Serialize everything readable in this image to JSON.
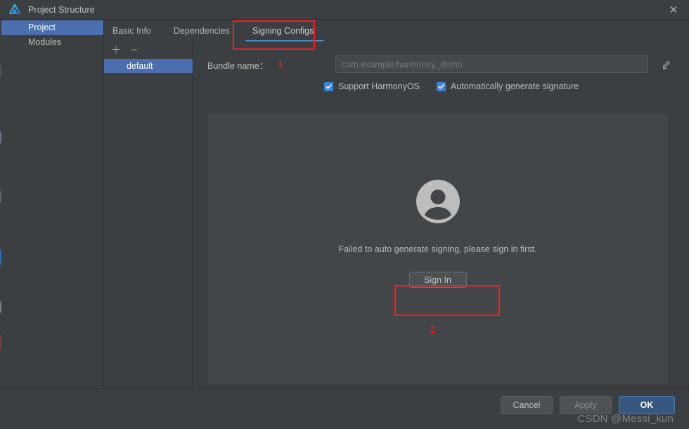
{
  "window": {
    "title": "Project Structure",
    "logo_icon": "deveco-studio-logo-icon",
    "close_icon": "close-icon",
    "close_glyph": "✕"
  },
  "categories": {
    "items": [
      {
        "label": "Project",
        "selected": true
      },
      {
        "label": "Modules",
        "selected": false
      }
    ]
  },
  "tabs": [
    {
      "label": "Basic Info",
      "active": false
    },
    {
      "label": "Dependencies",
      "active": false
    },
    {
      "label": "Signing Configs",
      "active": true
    }
  ],
  "configs_pane": {
    "add_icon": "plus-icon",
    "add_glyph": "＋",
    "remove_icon": "minus-icon",
    "remove_glyph": "−",
    "items": [
      {
        "label": "default",
        "selected": true
      }
    ]
  },
  "form": {
    "bundle_label": "Bundle name：",
    "bundle_value": "",
    "bundle_placeholder": "com.example.harmoney_demo",
    "edit_icon": "pencil-edit-icon",
    "checkboxes": [
      {
        "label": "Support HarmonyOS",
        "checked": true
      },
      {
        "label": "Automatically generate signature",
        "checked": true
      }
    ]
  },
  "signing_panel": {
    "avatar_icon": "user-avatar-icon",
    "message": "Failed to auto generate signing, please sign in first.",
    "sign_in_label": "Sign In"
  },
  "footer": {
    "cancel_label": "Cancel",
    "apply_label": "Apply",
    "ok_label": "OK"
  },
  "annotations": {
    "marker_1": "1",
    "marker_2": "2",
    "box_color": "#fb1b1b"
  },
  "watermark": {
    "text": "CSDN @Messi_kun"
  },
  "colors": {
    "window_bg": "#3c3f41",
    "panel_bg": "#434649",
    "selection_blue": "#4b6eaf",
    "accent_blue": "#4a88c7",
    "checkbox_blue": "#3b84d8",
    "ok_button_blue": "#365880",
    "annotation_red": "#fb1b1b"
  }
}
